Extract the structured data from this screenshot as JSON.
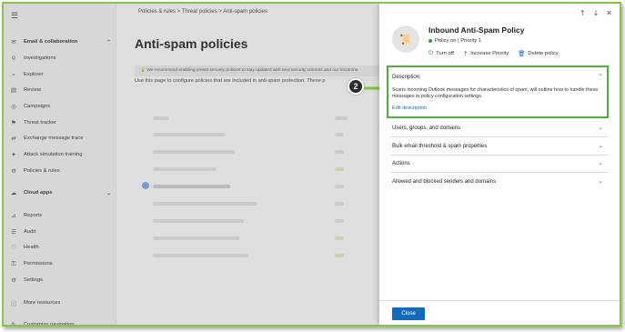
{
  "sidebar": {
    "items": [
      {
        "icon": "mail-icon",
        "glyph": "✉",
        "label": "Email & collaboration",
        "section": true,
        "chevron": "⌃"
      },
      {
        "icon": "investigations-icon",
        "glyph": "⚲",
        "label": "Investigations"
      },
      {
        "icon": "explorer-icon",
        "glyph": "⌕",
        "label": "Explorer"
      },
      {
        "icon": "review-icon",
        "glyph": "▤",
        "label": "Review"
      },
      {
        "icon": "campaigns-icon",
        "glyph": "◎",
        "label": "Campaigns"
      },
      {
        "icon": "threat-tracker-icon",
        "glyph": "⚑",
        "label": "Threat tracker"
      },
      {
        "icon": "message-trace-icon",
        "glyph": "⇄",
        "label": "Exchange message trace"
      },
      {
        "icon": "attack-sim-icon",
        "glyph": "✦",
        "label": "Attack simulation training"
      },
      {
        "icon": "policies-icon",
        "glyph": "⚙",
        "label": "Policies & rules"
      },
      {
        "icon": "cloud-icon",
        "glyph": "☁",
        "label": "Cloud apps",
        "section": true,
        "chevron": "⌄"
      },
      {
        "icon": "reports-icon",
        "glyph": "⊿",
        "label": "Reports"
      },
      {
        "icon": "audit-icon",
        "glyph": "☰",
        "label": "Audit"
      },
      {
        "icon": "health-icon",
        "glyph": "♡",
        "label": "Health"
      },
      {
        "icon": "permissions-icon",
        "glyph": "⚿",
        "label": "Permissions"
      },
      {
        "icon": "settings-icon",
        "glyph": "⚙",
        "label": "Settings"
      },
      {
        "icon": "more-resources-icon",
        "glyph": "ⓘ",
        "label": "More resources"
      },
      {
        "icon": "customize-icon",
        "glyph": "✎",
        "label": "Customize navigation"
      }
    ]
  },
  "main": {
    "breadcrumb": "Policies & rules  >  Threat policies  >  Anti-spam policies",
    "title": "Anti-spam policies",
    "notice": "We recommend enabling preset security policies to stay updated with new security controls and our recomme",
    "intro": "Use this page to configure policies that are included in anti-spam protection. These p"
  },
  "panel": {
    "nav_up": "↑",
    "nav_down": "↓",
    "nav_close": "✕",
    "title": "Inbound Anti-Spam Policy",
    "status": "Policy on | Priority 1",
    "actions": [
      {
        "icon": "power-icon",
        "glyph": "⏻",
        "label": "Turn off"
      },
      {
        "icon": "arrow-up-icon",
        "glyph": "↑",
        "label": "Increase Priority"
      },
      {
        "icon": "trash-icon",
        "glyph": "🗑",
        "label": "Delete policy"
      }
    ],
    "description": {
      "heading": "Description",
      "text": "Scans incoming Outlook messages for characteristics of spam, will outline how to handle these messages in policy configuration settings.",
      "edit_link": "Edit description"
    },
    "sections": [
      "Users, groups, and domains",
      "Bulk email threshold & spam properties",
      "Actions",
      "Allowed and blocked senders and domains"
    ],
    "close_label": "Close"
  },
  "annotation": {
    "badge": "2"
  },
  "colors": {
    "accent": "#0f6cbd",
    "highlight": "#5aa845",
    "status_on": "#3a9b3a"
  }
}
